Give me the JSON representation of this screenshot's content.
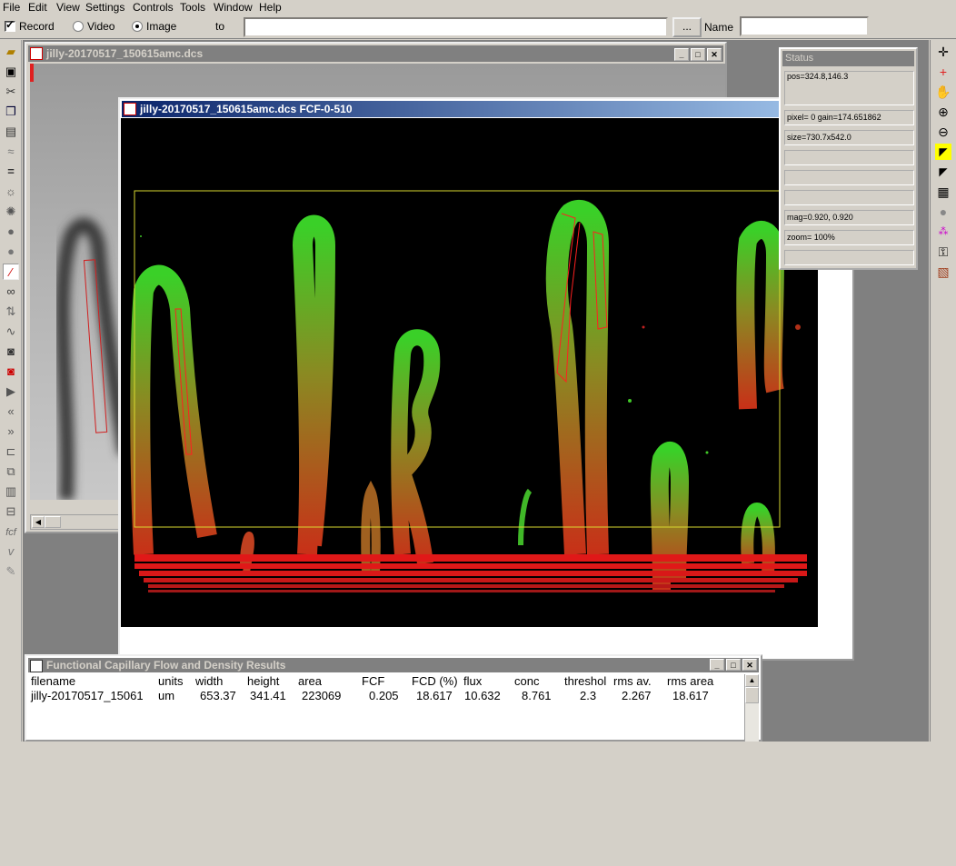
{
  "menu": [
    "File",
    "Edit",
    "View",
    "Settings",
    "Controls",
    "Tools",
    "Window",
    "Help"
  ],
  "controls": {
    "record_label": "Record",
    "video_label": "Video",
    "image_label": "Image",
    "to_label": "to",
    "browse_label": "...",
    "name_label": "Name",
    "name_value": ""
  },
  "windows": {
    "background_title": "jilly-20170517_150615amc.dcs",
    "front_title": "jilly-20170517_150615amc.dcs FCF-0-510",
    "results_title": "Functional Capillary Flow and Density Results"
  },
  "status": {
    "title": "Status",
    "pos": "pos=324.8,146.3",
    "pixel": "pixel=  0 gain=174.651862",
    "size": "size=730.7x542.0",
    "mag": "mag=0.920, 0.920",
    "zoom": "zoom= 100%"
  },
  "results": {
    "headers": [
      "filename",
      "units",
      "width",
      "height",
      "area",
      "FCF",
      "FCD (%)",
      "flux",
      "conc",
      "threshol",
      "rms av.",
      "rms area"
    ],
    "row": [
      "jilly-20170517_15061",
      "um",
      "653.37",
      "341.41",
      "223069",
      "0.205",
      "18.617",
      "10.632",
      "8.761",
      "2.3",
      "2.267",
      "18.617"
    ]
  },
  "colors": {
    "capillary_green": "#3fc832",
    "capillary_red": "#e02020",
    "roi_yellow": "#d8d830",
    "titlebar_active": "#0a246a"
  },
  "icons": {
    "left": [
      "open-icon",
      "save-icon",
      "cut-icon",
      "copy-icon",
      "paste-icon",
      "wave-icon",
      "equals-icon",
      "brightness-icon",
      "contrast-icon",
      "circle-icon",
      "dot-icon",
      "line-tool-icon",
      "glasses-icon",
      "arrows-icon",
      "waveform-icon",
      "camera-icon",
      "record-camera-icon",
      "play-icon",
      "rewind-icon",
      "fastforward-icon",
      "loop-icon",
      "frames-icon",
      "stack-icon",
      "export-icon",
      "fcf-icon",
      "velocity-icon",
      "pen-icon"
    ],
    "right": [
      "crosshair-icon",
      "red-crosshair-icon",
      "hand-icon",
      "zoom-in-icon",
      "zoom-out-icon",
      "marker-yellow-icon",
      "marker-black-icon",
      "grid-icon",
      "circle-gray-icon",
      "nodes-icon",
      "lock-icon",
      "image-icon"
    ]
  }
}
